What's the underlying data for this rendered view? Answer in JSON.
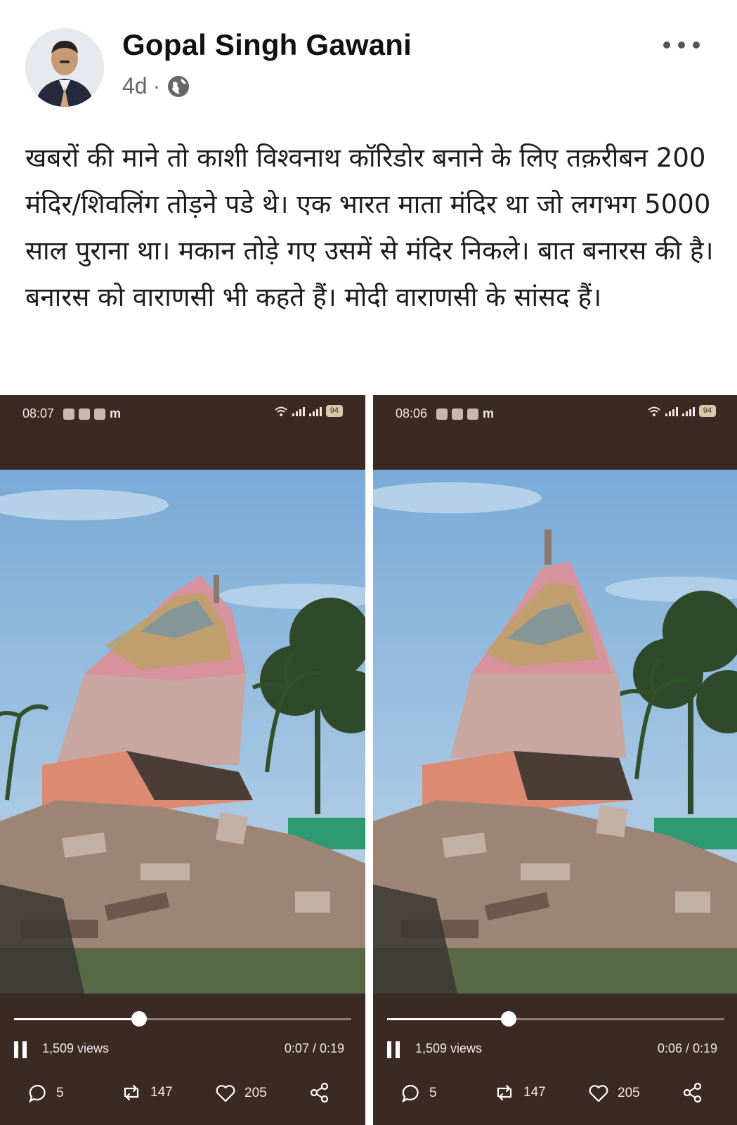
{
  "post": {
    "author": "Gopal Singh Gawani",
    "age": "4d",
    "separator": "·",
    "privacy_icon": "globe-icon",
    "more_icon": "more-dots-icon",
    "text": "खबरों की माने तो काशी विश्वनाथ कॉरिडोर बनाने के लिए तक़रीबन 200 मंदिर/शिवलिंग तोड़ने पडे थे। एक भारत माता मंदिर था जो लगभग 5000 साल पुराना था। मकान तोड़े गए उसमें से मंदिर निकले। बात बनारस की है। बनारस को वाराणसी भी कहते हैं। मोदी वाराणसी के सांसद हैं।"
  },
  "screenshots": [
    {
      "status_time": "08:07",
      "status_m": "m",
      "battery": "94",
      "views": "1,509 views",
      "duration": "0:07 / 0:19",
      "progress": 0.37,
      "comments": "5",
      "reposts": "147",
      "likes": "205"
    },
    {
      "status_time": "08:06",
      "status_m": "m",
      "battery": "94",
      "views": "1,509 views",
      "duration": "0:06 / 0:19",
      "progress": 0.36,
      "comments": "5",
      "reposts": "147",
      "likes": "205"
    }
  ],
  "colors": {
    "screenshot_bg": "#3b2a24",
    "sky": "#8ab6dc",
    "temple_pink": "#d89aa0",
    "debris": "#9d8576"
  }
}
